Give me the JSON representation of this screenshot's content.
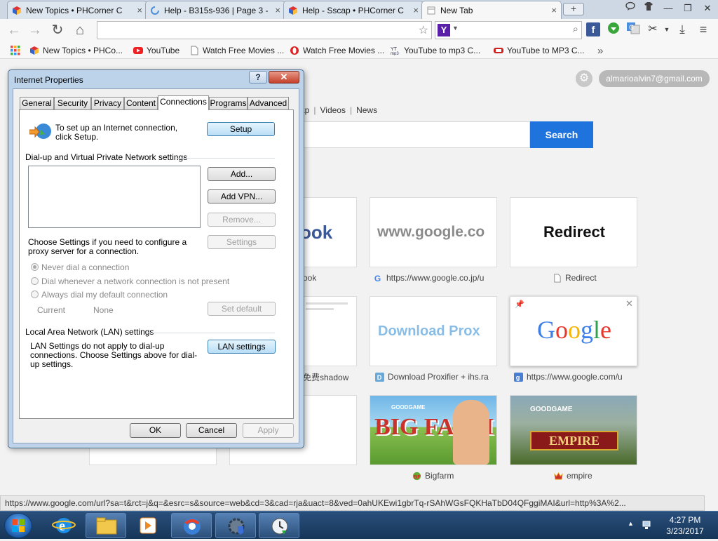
{
  "tabs": [
    {
      "label": "New Topics • PHCorner C",
      "close": "×"
    },
    {
      "label": "Help - B315s-936 | Page 3 -",
      "close": "×"
    },
    {
      "label": "Help - Sscap • PHCorner C",
      "close": "×"
    },
    {
      "label": "New Tab",
      "close": "×"
    }
  ],
  "newtab": "+",
  "window_controls": {
    "minimize": "—",
    "restore": "❐",
    "close": "✕"
  },
  "nav": {
    "back": "←",
    "forward": "→",
    "reload": "↻",
    "home": "⌂",
    "star": "☆",
    "search_glyph": "⌕",
    "yahoo": "Y",
    "menu": "≡",
    "download": "⤓",
    "cut": "✂"
  },
  "omnibox": {
    "value": ""
  },
  "bookmarks": [
    {
      "label": "New Topics • PHCo..."
    },
    {
      "label": "YouTube"
    },
    {
      "label": "Watch Free Movies ..."
    },
    {
      "label": "Watch Free Movies ..."
    },
    {
      "label": "YouTube to mp3 C..."
    },
    {
      "label": "YouTube to MP3 C..."
    }
  ],
  "bookmarks_more": "»",
  "newtab_page": {
    "account": "almarioalvin7@gmail.com",
    "nav_links": [
      "ap",
      "Videos",
      "News"
    ],
    "nav_sep": "|",
    "search_button": "Search",
    "tiles": [
      {
        "thumb_text": "ook",
        "caption": "ook"
      },
      {
        "thumb_text": "www.google.co",
        "caption": "https://www.google.co.jp/u"
      },
      {
        "thumb_text": "Redirect",
        "caption": "Redirect"
      },
      {
        "thumb_text": "",
        "caption": "免费shadow"
      },
      {
        "thumb_text": "Download Prox",
        "caption": "Download Proxifier + ihs.ra"
      },
      {
        "thumb_text": "Google",
        "caption": "https://www.google.com/u"
      },
      {
        "thumb_text": "",
        "caption": ""
      },
      {
        "thumb_text": "",
        "caption": ""
      },
      {
        "thumb_text": "BIG FARM",
        "caption": "Bigfarm",
        "badge": "GOODGAME"
      },
      {
        "thumb_text": "EMPIRE",
        "caption": "empire",
        "badge": "GOODGAME"
      }
    ]
  },
  "status_url": "https://www.google.com/url?sa=t&rct=j&q=&esrc=s&source=web&cd=3&cad=rja&uact=8&ved=0ahUKEwi1gbrTq-rSAhWGsFQKHaTbD04QFggiMAI&url=http%3A%2...",
  "dialog": {
    "title": "Internet Properties",
    "help": "?",
    "close": "✕",
    "tabs": [
      "General",
      "Security",
      "Privacy",
      "Content",
      "Connections",
      "Programs",
      "Advanced"
    ],
    "setup_text": "To set up an Internet connection, click Setup.",
    "setup_button": "Setup",
    "dialup_heading": "Dial-up and Virtual Private Network settings",
    "add_button": "Add...",
    "add_vpn_button": "Add VPN...",
    "remove_button": "Remove...",
    "settings_text": "Choose Settings if you need to configure a proxy server for a connection.",
    "settings_button": "Settings",
    "radios": [
      "Never dial a connection",
      "Dial whenever a network connection is not present",
      "Always dial my default connection"
    ],
    "current_label": "Current",
    "current_value": "None",
    "set_default_button": "Set default",
    "lan_heading": "Local Area Network (LAN) settings",
    "lan_text": "LAN Settings do not apply to dial-up connections. Choose Settings above for dial-up settings.",
    "lan_button": "LAN settings",
    "ok": "OK",
    "cancel": "Cancel",
    "apply": "Apply"
  },
  "taskbar": {
    "time": "4:27 PM",
    "date": "3/23/2017",
    "tray_arrow": "▲"
  },
  "colors": {
    "accent": "#1e73dc",
    "dialog_frame": "#bcd3ea",
    "taskbar": "#1e3f68"
  }
}
